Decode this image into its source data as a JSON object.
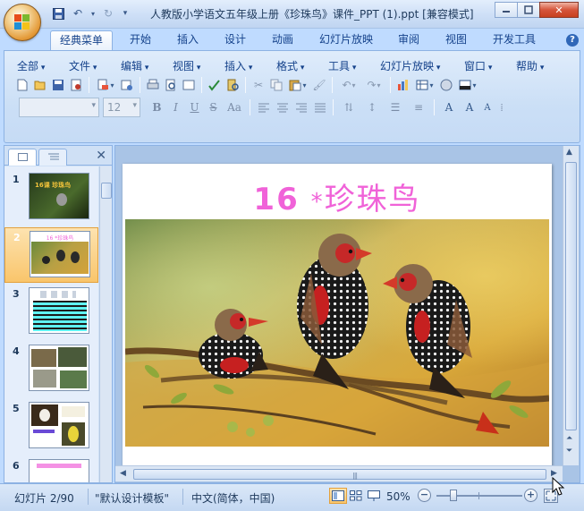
{
  "window": {
    "title": "人教版小学语文五年级上册《珍珠鸟》课件_PPT (1).ppt [兼容模式]"
  },
  "ribbon_tabs": [
    "经典菜单",
    "开始",
    "插入",
    "设计",
    "动画",
    "幻灯片放映",
    "审阅",
    "视图",
    "开发工具"
  ],
  "menu_bar": [
    "全部",
    "文件",
    "编辑",
    "视图",
    "插入",
    "格式",
    "工具",
    "幻灯片放映",
    "窗口",
    "帮助"
  ],
  "format_bar": {
    "font_size": "12",
    "bold": "B",
    "italic": "I",
    "underline": "U",
    "strike": "S",
    "case": "Aa"
  },
  "slide_panel": {
    "thumbnails": [
      {
        "number": "1",
        "caption": "16课 珍珠鸟"
      },
      {
        "number": "2",
        "caption": "16 *珍珠鸟"
      },
      {
        "number": "3",
        "caption": ""
      },
      {
        "number": "4",
        "caption": ""
      },
      {
        "number": "5",
        "caption": ""
      },
      {
        "number": "6",
        "caption": ""
      }
    ],
    "selected_index": 2
  },
  "slide": {
    "title_number": "16",
    "title_star": "*",
    "title_text": "珍珠鸟"
  },
  "status_bar": {
    "slide_counter": "幻灯片 2/90",
    "theme": "\"默认设计模板\"",
    "language": "中文(简体，中国)",
    "zoom": "50%"
  },
  "colors": {
    "title_pink": "#f062d8",
    "ribbon_blue": "#bfdbff",
    "selection_orange": "#f9c56b"
  }
}
